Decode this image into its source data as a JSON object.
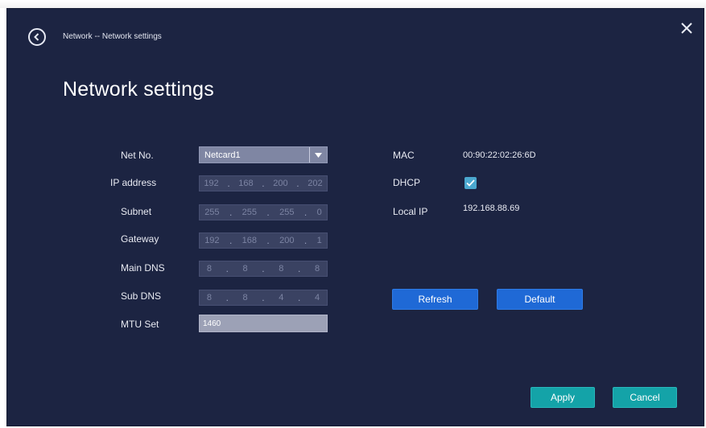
{
  "header": {
    "breadcrumb": "Network -- Network settings",
    "back_icon": "chevron-left-circle-icon",
    "close_icon": "close-icon"
  },
  "page": {
    "title": "Network settings"
  },
  "form": {
    "net_no": {
      "label": "Net No.",
      "value": "Netcard1"
    },
    "ip_address": {
      "label": "IP address",
      "octets": [
        "192",
        "168",
        "200",
        "202"
      ]
    },
    "subnet": {
      "label": "Subnet",
      "octets": [
        "255",
        "255",
        "255",
        "0"
      ]
    },
    "gateway": {
      "label": "Gateway",
      "octets": [
        "192",
        "168",
        "200",
        "1"
      ]
    },
    "main_dns": {
      "label": "Main DNS",
      "octets": [
        "8",
        "8",
        "8",
        "8"
      ]
    },
    "sub_dns": {
      "label": "Sub DNS",
      "octets": [
        "8",
        "8",
        "4",
        "4"
      ]
    },
    "mtu": {
      "label": "MTU Set",
      "value": "1460"
    }
  },
  "info": {
    "mac": {
      "label": "MAC",
      "value": "00:90:22:02:26:6D"
    },
    "dhcp": {
      "label": "DHCP",
      "checked": true
    },
    "local_ip": {
      "label": "Local IP",
      "value": "192.168.88.69"
    }
  },
  "buttons": {
    "refresh": "Refresh",
    "default": "Default",
    "apply": "Apply",
    "cancel": "Cancel"
  },
  "colors": {
    "background": "#1c2442",
    "primary_button": "#1f69d6",
    "accent_button": "#14a3a8"
  }
}
